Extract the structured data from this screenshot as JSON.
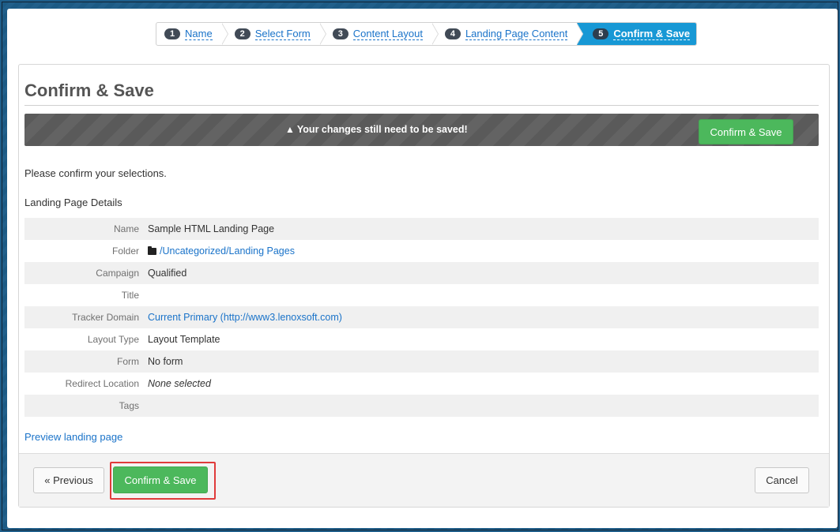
{
  "wizard": {
    "steps": [
      {
        "num": "1",
        "label": "Name"
      },
      {
        "num": "2",
        "label": "Select Form"
      },
      {
        "num": "3",
        "label": "Content Layout"
      },
      {
        "num": "4",
        "label": "Landing Page Content"
      },
      {
        "num": "5",
        "label": "Confirm & Save"
      }
    ]
  },
  "panel": {
    "title": "Confirm & Save",
    "alert_message": "Your changes still need to be saved!",
    "alert_button": "Confirm & Save",
    "intro": "Please confirm your selections.",
    "section_heading": "Landing Page Details"
  },
  "details": [
    {
      "key": "Name",
      "value": "Sample HTML Landing Page"
    },
    {
      "key": "Folder",
      "value": "/Uncategorized/Landing Pages"
    },
    {
      "key": "Campaign",
      "value": "Qualified"
    },
    {
      "key": "Title",
      "value": ""
    },
    {
      "key": "Tracker Domain",
      "value": "Current Primary (http://www3.lenoxsoft.com)"
    },
    {
      "key": "Layout Type",
      "value": "Layout Template"
    },
    {
      "key": "Form",
      "value": "No form"
    },
    {
      "key": "Redirect Location",
      "value": "None selected"
    },
    {
      "key": "Tags",
      "value": ""
    }
  ],
  "preview_link": "Preview landing page",
  "footer": {
    "previous": "« Previous",
    "confirm": "Confirm & Save",
    "cancel": "Cancel"
  },
  "icons": {
    "warning": "warning-triangle-icon",
    "folder": "folder-icon"
  },
  "colors": {
    "accent": "#1798d5",
    "success": "#4cb85c",
    "link": "#1a73c9",
    "highlight": "#e03b3b"
  }
}
